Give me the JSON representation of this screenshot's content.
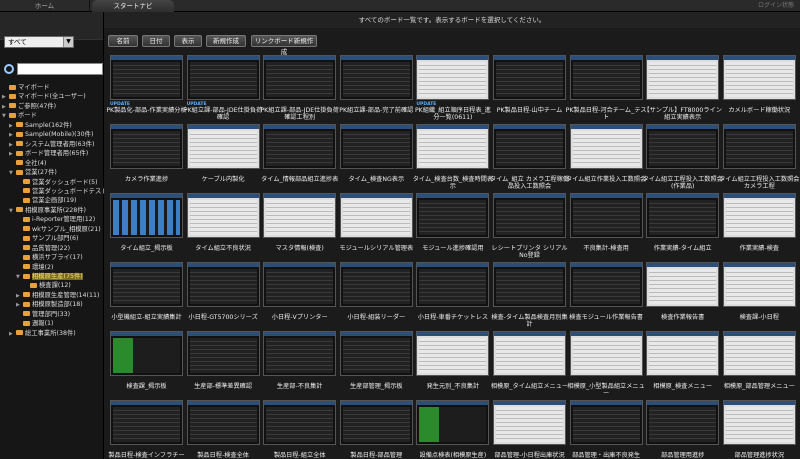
{
  "tabs": {
    "home": "ホーム",
    "start_nav": "スタートナビ",
    "right_label": "ログイン状態"
  },
  "left": {
    "filter_value": "すべて",
    "tree": [
      {
        "label": "マイボード",
        "level": 0,
        "toggle": "",
        "color": "#e8a03a"
      },
      {
        "label": "マイボード(全ユーザー)",
        "level": 0,
        "toggle": "▶",
        "color": "#e8a03a"
      },
      {
        "label": "ご参照(47件)",
        "level": 0,
        "toggle": "▶",
        "color": "#e8a03a"
      },
      {
        "label": "ボード",
        "level": 0,
        "toggle": "▼",
        "color": "#e8a03a"
      },
      {
        "label": "Sample(162件)",
        "level": 1,
        "toggle": "▶",
        "color": "#e8a03a"
      },
      {
        "label": "Sample(Mobile)(30件)",
        "level": 1,
        "toggle": "▶",
        "color": "#e8a03a"
      },
      {
        "label": "システム管理者用(63件)",
        "level": 1,
        "toggle": "▶",
        "color": "#e8a03a"
      },
      {
        "label": "ボード管理者用(65件)",
        "level": 1,
        "toggle": "▶",
        "color": "#e8a03a"
      },
      {
        "label": "全社(4)",
        "level": 1,
        "toggle": "",
        "color": "#e8a03a"
      },
      {
        "label": "営業(27件)",
        "level": 1,
        "toggle": "▼",
        "color": "#e8a03a"
      },
      {
        "label": "営業ダッシュボード(5)",
        "level": 2,
        "toggle": "",
        "color": "#e8a03a"
      },
      {
        "label": "営業ダッシュボードテスト用(",
        "level": 2,
        "toggle": "",
        "color": "#e8a03a"
      },
      {
        "label": "営業企画部(19)",
        "level": 2,
        "toggle": "",
        "color": "#e8a03a"
      },
      {
        "label": "相模原事業所(228件)",
        "level": 1,
        "toggle": "▼",
        "color": "#e8a03a"
      },
      {
        "label": "i-Reporter管理用(12)",
        "level": 2,
        "toggle": "",
        "color": "#e8a03a"
      },
      {
        "label": "wkサンプル_相模原(21)",
        "level": 2,
        "toggle": "",
        "color": "#e8a03a"
      },
      {
        "label": "サンプル部門(6)",
        "level": 2,
        "toggle": "",
        "color": "#e8a03a"
      },
      {
        "label": "品質管理(22)",
        "level": 2,
        "toggle": "",
        "color": "#e8a03a"
      },
      {
        "label": "横浜サプライ(17)",
        "level": 2,
        "toggle": "",
        "color": "#e8a03a"
      },
      {
        "label": "環境(2)",
        "level": 2,
        "toggle": "",
        "color": "#e8a03a"
      },
      {
        "label": "相模原生産(75件)",
        "level": 2,
        "toggle": "▼",
        "color": "#e8a03a",
        "selected": true
      },
      {
        "label": "検査課(12)",
        "level": 3,
        "toggle": "",
        "color": "#e8a03a"
      },
      {
        "label": "相模原生産管理(14(11)",
        "level": 2,
        "toggle": "▶",
        "color": "#e8a03a"
      },
      {
        "label": "相模原製造部(18)",
        "level": 2,
        "toggle": "▶",
        "color": "#e8a03a"
      },
      {
        "label": "管理部門(33)",
        "level": 2,
        "toggle": "",
        "color": "#e8a03a"
      },
      {
        "label": "週報(1)",
        "level": 2,
        "toggle": "",
        "color": "#e8a03a"
      },
      {
        "label": "総工事業所(38件)",
        "level": 1,
        "toggle": "▶",
        "color": "#e8a03a"
      }
    ]
  },
  "main": {
    "notice": "すべてのボード一覧です。表示するボードを選択してください。",
    "buttons": [
      "名前",
      "日付",
      "表示",
      "新規作成",
      "リンクボード新規作成"
    ],
    "update_label": "UPDATE",
    "cards": [
      {
        "label": "PK製品化-部品-作業実績分析",
        "style": "dark",
        "update": true
      },
      {
        "label": "PK組立課-部品-JDE仕掛負荷確認",
        "style": "dark",
        "update": true
      },
      {
        "label": "PK組立課-部品-JDE仕掛負荷確認工程別",
        "style": "dark",
        "update": false
      },
      {
        "label": "PK組立課-部品-完了前確認",
        "style": "dark",
        "update": false
      },
      {
        "label": "PK組織_組立順序日程表_進分一覧(0611)",
        "style": "light",
        "update": true
      },
      {
        "label": "PK製品日程-山中チーム",
        "style": "dark",
        "update": false
      },
      {
        "label": "PK製品日程-河合チーム_テスト",
        "style": "dark",
        "update": false
      },
      {
        "label": "【サンプル】FT8000ライン組立実績表示",
        "style": "light",
        "update": false
      },
      {
        "label": "カメルボード稼働状況",
        "style": "light",
        "update": false
      },
      {
        "label": "カメラ作業進捗",
        "style": "dark",
        "update": false
      },
      {
        "label": "ケーブル内製化",
        "style": "light",
        "update": false
      },
      {
        "label": "タイム_情報部品組立進捗表",
        "style": "dark",
        "update": false
      },
      {
        "label": "タイム_検査NG表示",
        "style": "dark",
        "update": false
      },
      {
        "label": "タイム_検査台数_検査時間表示",
        "style": "light",
        "update": false
      },
      {
        "label": "タイム_組立 カメラ工程稼働品投入工数照会",
        "style": "dark",
        "update": false
      },
      {
        "label": "タイム組立作業投入工数照会",
        "style": "light",
        "update": false
      },
      {
        "label": "タイム組立工程投入工数照会(作業品)",
        "style": "dark",
        "update": false
      },
      {
        "label": "タイム組立工程投入工数照会カメラ工程",
        "style": "dark",
        "update": false
      },
      {
        "label": "タイム組立_揭示板",
        "style": "blue",
        "update": false
      },
      {
        "label": "タイム組立不良状況",
        "style": "light",
        "update": false
      },
      {
        "label": "マスタ情報(検査)",
        "style": "light",
        "update": false
      },
      {
        "label": "モジュールシリアル管理表",
        "style": "light",
        "update": false
      },
      {
        "label": "モジュール進捗確認用",
        "style": "dark",
        "update": false
      },
      {
        "label": "レシートプリンタ シリアルNo登録",
        "style": "dark",
        "update": false
      },
      {
        "label": "不良集計-検査用",
        "style": "dark",
        "update": false
      },
      {
        "label": "作業実績-タイム組立",
        "style": "dark",
        "update": false
      },
      {
        "label": "作業実績-検査",
        "style": "light",
        "update": false
      },
      {
        "label": "小型機組立-組立実績集計",
        "style": "dark",
        "update": false
      },
      {
        "label": "小日程-GT5700シリーズ",
        "style": "dark",
        "update": false
      },
      {
        "label": "小日程-Vプリンター",
        "style": "dark",
        "update": false
      },
      {
        "label": "小日程-組装リーダー",
        "style": "dark",
        "update": false
      },
      {
        "label": "小日程-車番チケットレス",
        "style": "dark",
        "update": false
      },
      {
        "label": "検査-タイム製品検査月別集計",
        "style": "dark",
        "update": false
      },
      {
        "label": "検査モジュール作業報告書",
        "style": "dark",
        "update": false
      },
      {
        "label": "検査作業報告書",
        "style": "light",
        "update": false
      },
      {
        "label": "検査課-小日程",
        "style": "light",
        "update": false
      },
      {
        "label": "検査課_揭示板",
        "style": "green",
        "update": false
      },
      {
        "label": "生産部-標準差異確認",
        "style": "dark",
        "update": false
      },
      {
        "label": "生産部-不良集計",
        "style": "dark",
        "update": false
      },
      {
        "label": "生産部管理_揭示板",
        "style": "dark",
        "update": false
      },
      {
        "label": "発生元別_不良集計",
        "style": "light",
        "update": false
      },
      {
        "label": "相模原_タイム組立メニュー",
        "style": "light",
        "update": false
      },
      {
        "label": "相模原_小型製品組立メニュー",
        "style": "light",
        "update": false
      },
      {
        "label": "相模原_検査メニュー",
        "style": "light",
        "update": false
      },
      {
        "label": "相模原_部品管理メニュー",
        "style": "light",
        "update": false
      },
      {
        "label": "製品日程-検査インフラチー",
        "style": "dark",
        "update": false
      },
      {
        "label": "製品日程-検査全体",
        "style": "dark",
        "update": false
      },
      {
        "label": "製品日程-組立全体",
        "style": "dark",
        "update": false
      },
      {
        "label": "製品日程-部品管理",
        "style": "dark",
        "update": false
      },
      {
        "label": "設備点検表(相模原生産)",
        "style": "green",
        "update": false
      },
      {
        "label": "部品管理-小日程出庫状況",
        "style": "light",
        "update": false
      },
      {
        "label": "部品管理・出庫不良発生",
        "style": "dark",
        "update": false
      },
      {
        "label": "部品管理用進捗",
        "style": "dark",
        "update": false
      },
      {
        "label": "部品管理進捗状況",
        "style": "light",
        "update": false
      }
    ]
  }
}
